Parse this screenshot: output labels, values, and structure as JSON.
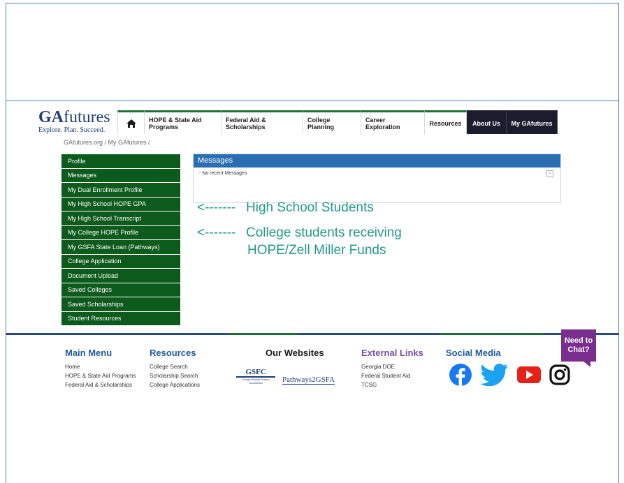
{
  "logo": {
    "title_bold": "GA",
    "title_rest": "futures",
    "tagline": "Explore. Plan. Succeed."
  },
  "nav": {
    "tabs": [
      {
        "label": "HOPE & State Aid Programs"
      },
      {
        "label": "Federal Aid & Scholarships"
      },
      {
        "label": "College Planning"
      },
      {
        "label": "Career Exploration"
      },
      {
        "label": "Resources"
      },
      {
        "label": "About Us"
      },
      {
        "label": "My GAfutures"
      }
    ]
  },
  "breadcrumb": "GAfutures.org / My GAfutures /",
  "sidebar": {
    "items": [
      "Profile",
      "Messages",
      "My Dual Enrollment Profile",
      "My High School HOPE GPA",
      "My High School Transcript",
      "My College HOPE Profile",
      "My GSFA State Loan (Pathways)",
      "College Application",
      "Document Upload",
      "Saved Colleges",
      "Saved Scholarships",
      "Student Resources"
    ]
  },
  "messages": {
    "title": "Messages",
    "empty": "- No recent Messages"
  },
  "annotations": {
    "arrow": "<-------",
    "high_school": "High School Students",
    "college_line1": "College students receiving",
    "college_line2": "HOPE/Zell Miller Funds"
  },
  "footer": {
    "main_menu": {
      "title": "Main Menu",
      "links": [
        "Home",
        "HOPE & State Aid Programs",
        "Federal Aid & Scholarships"
      ]
    },
    "resources": {
      "title": "Resources",
      "links": [
        "College Search",
        "Scholarship Search",
        "College Applications"
      ]
    },
    "websites": {
      "title": "Our Websites",
      "gsfc": "GSFC",
      "gsfc_sub": "Georgia Student Finance Commission",
      "pathways": "Pathways2GSFA"
    },
    "external": {
      "title": "External Links",
      "links": [
        "Georgia DOE",
        "Federal Student Aid",
        "TCSG"
      ]
    },
    "social": {
      "title": "Social Media",
      "icons": [
        "facebook-icon",
        "twitter-icon",
        "youtube-icon",
        "instagram-icon"
      ]
    }
  },
  "chat": {
    "line1": "Need to",
    "line2": "Chat?"
  },
  "colors": {
    "sidebar_green": "#0d5a1d",
    "message_blue": "#2a6fb3",
    "annotation": "#22998c",
    "chat_purple": "#7a2f8f"
  }
}
